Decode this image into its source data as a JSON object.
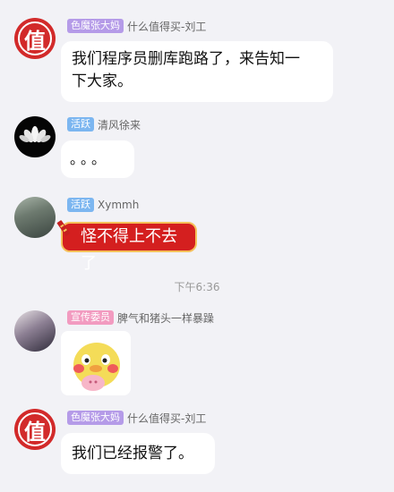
{
  "messages": [
    {
      "badge": "色魔张大妈",
      "username": "什么值得买-刘工",
      "avatar_icon": "zhi-logo-icon",
      "avatar_char": "值",
      "text_lines": [
        "我们程序员删库跑路了，来告知一",
        "下大家。"
      ]
    },
    {
      "badge": "活跃",
      "username": "清风徐来",
      "avatar_icon": "lotus-avatar-icon",
      "text": "。。。"
    },
    {
      "badge": "活跃",
      "username": "Xymmh",
      "avatar_icon": "photo-avatar-icon",
      "text": "怪不得上不去了"
    },
    {
      "badge": "宣传委员",
      "username": "脾气和猪头一样暴躁",
      "avatar_icon": "anime-avatar-icon",
      "sticker": "duck-sticker-icon"
    },
    {
      "badge": "色魔张大妈",
      "username": "什么值得买-刘工",
      "avatar_icon": "zhi-logo-icon",
      "avatar_char": "值",
      "text": "我们已经报警了。"
    }
  ],
  "timestamp": "下午6:36",
  "colors": {
    "background": "#f2f2f6",
    "badge_purple": "#b59be8",
    "badge_blue": "#7cb6f0",
    "badge_pink": "#f29bc0",
    "red_bubble": "#d41f1f",
    "red_bubble_border": "#f5c15a"
  }
}
